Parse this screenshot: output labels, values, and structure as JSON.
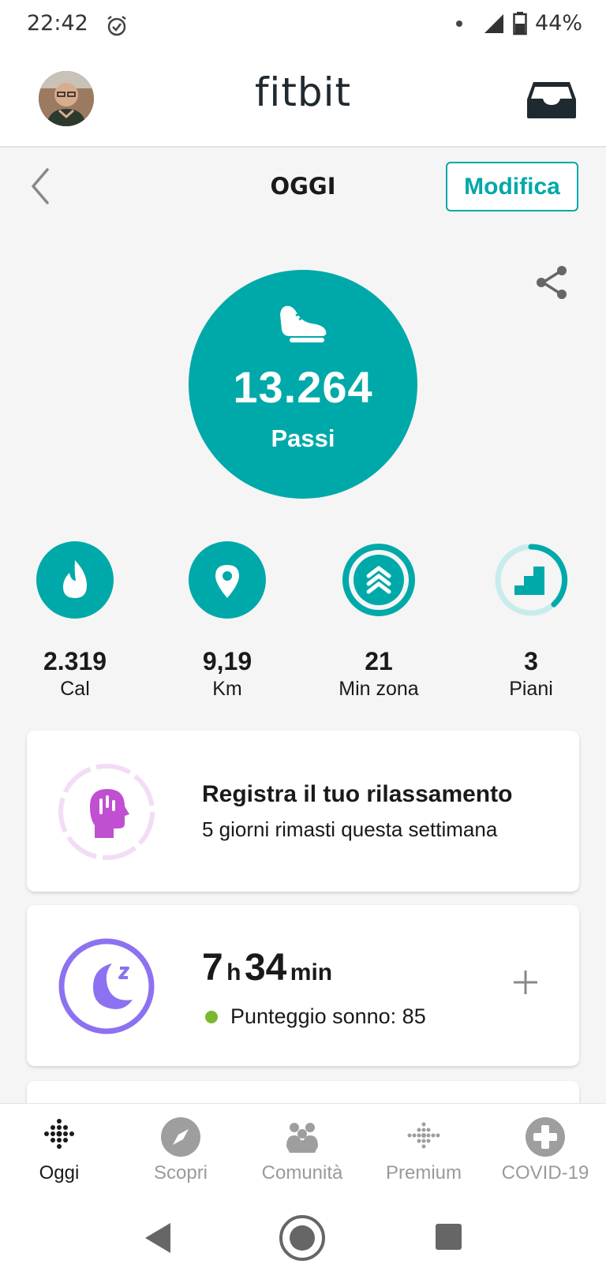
{
  "status_bar": {
    "time": "22:42",
    "battery": "44%"
  },
  "header": {
    "brand": "fitbit",
    "accent_color": "#00a9a9"
  },
  "date_row": {
    "title": "OGGI",
    "edit_label": "Modifica"
  },
  "steps": {
    "value": "13.264",
    "label": "Passi"
  },
  "metrics": [
    {
      "value": "2.319",
      "label": "Cal",
      "icon": "flame-icon"
    },
    {
      "value": "9,19",
      "label": "Km",
      "icon": "location-pin-icon"
    },
    {
      "value": "21",
      "label": "Min zona",
      "icon": "active-zone-icon"
    },
    {
      "value": "3",
      "label": "Piani",
      "icon": "stairs-icon"
    }
  ],
  "relax_card": {
    "title": "Registra il tuo rilassamento",
    "subtitle": "5 giorni rimasti questa settimana"
  },
  "sleep_card": {
    "hours": "7",
    "hours_unit": "h",
    "minutes": "34",
    "minutes_unit": "min",
    "score": "Punteggio sonno: 85"
  },
  "bottom_nav": [
    {
      "label": "Oggi",
      "icon": "today-dots-icon",
      "active": true
    },
    {
      "label": "Scopri",
      "icon": "compass-icon",
      "active": false
    },
    {
      "label": "Comunità",
      "icon": "community-icon",
      "active": false
    },
    {
      "label": "Premium",
      "icon": "premium-dots-icon",
      "active": false
    },
    {
      "label": "COVID-19",
      "icon": "covid-cross-icon",
      "active": false
    }
  ]
}
